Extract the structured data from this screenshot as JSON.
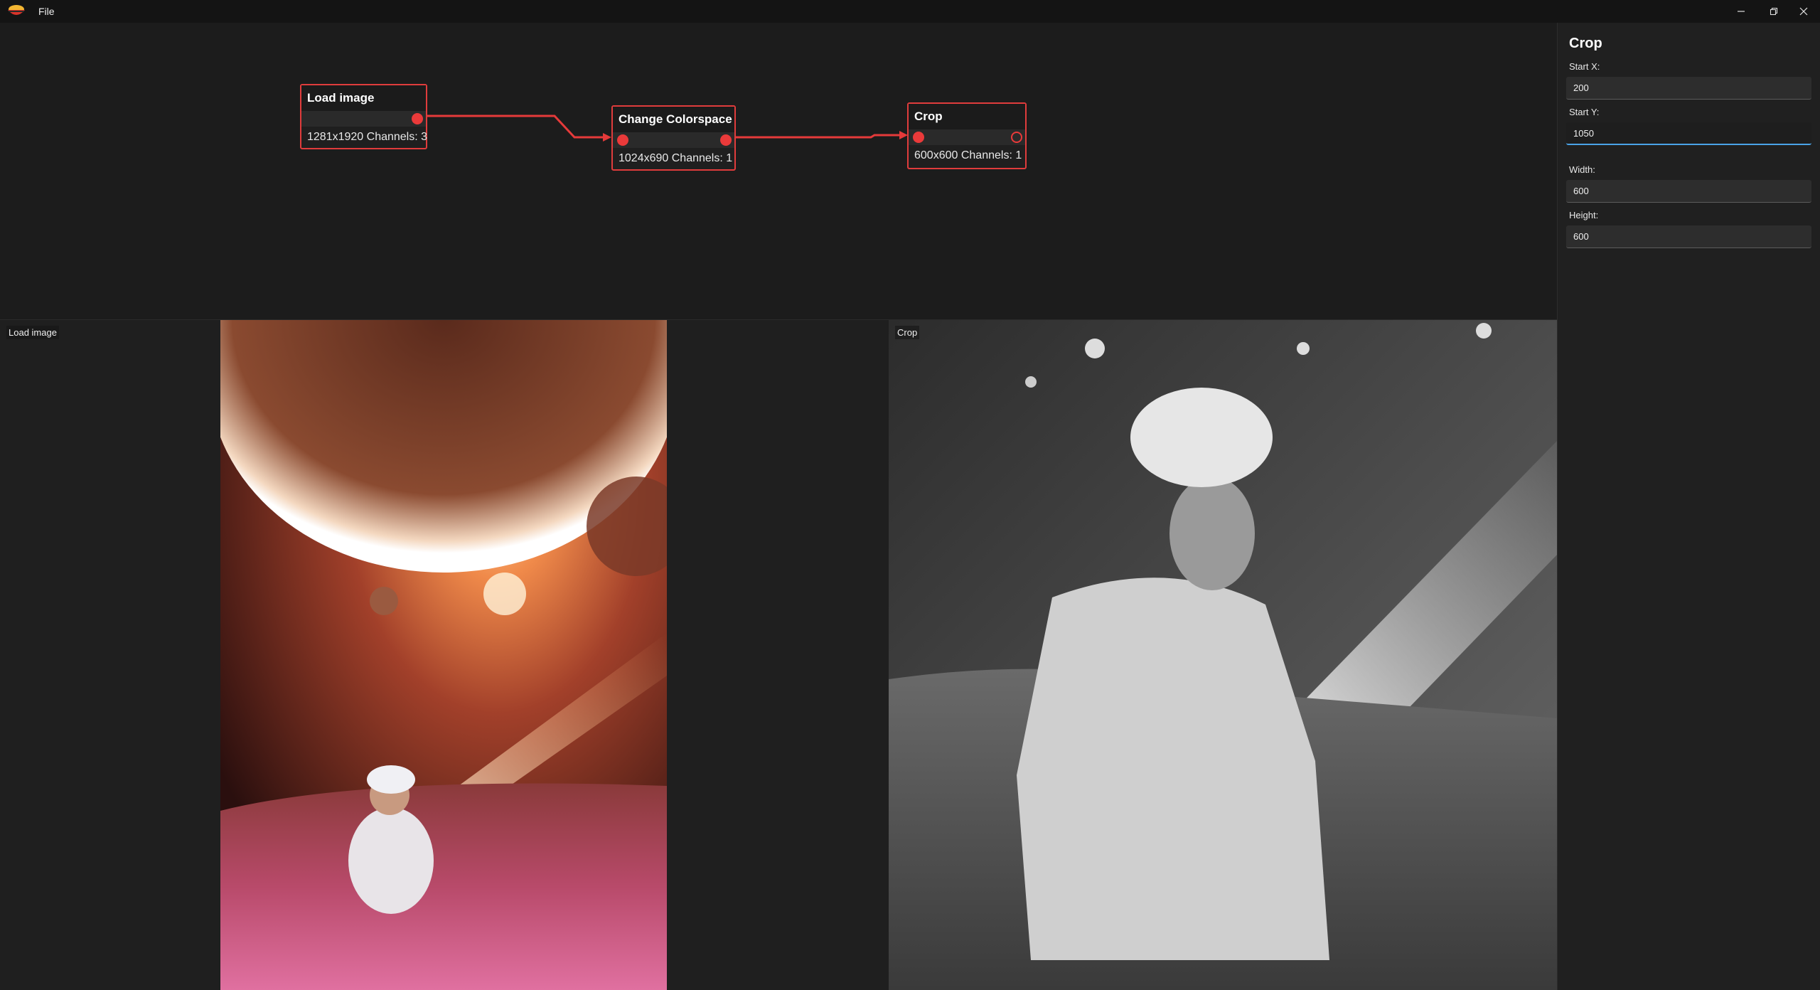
{
  "titlebar": {
    "menu_file": "File",
    "icons": [
      "app-logo-icon",
      "minimize-icon",
      "restore-icon",
      "close-icon"
    ]
  },
  "nodes": [
    {
      "title": "Load image",
      "info": "1281x1920 Channels: 3"
    },
    {
      "title": "Change Colorspace",
      "info": "1024x690 Channels: 1"
    },
    {
      "title": "Crop",
      "info": "600x600 Channels: 1"
    }
  ],
  "colors": {
    "accent": "#e03c3c",
    "focus": "#4aa3e8",
    "background": "#1c1c1c"
  },
  "viewers": {
    "left_label": "Load image",
    "right_label": "Crop"
  },
  "properties": {
    "title": "Crop",
    "start_x_label": "Start X:",
    "start_x_value": "200",
    "start_y_label": "Start Y:",
    "start_y_value": "1050",
    "width_label": "Width:",
    "width_value": "600",
    "height_label": "Height:",
    "height_value": "600"
  }
}
